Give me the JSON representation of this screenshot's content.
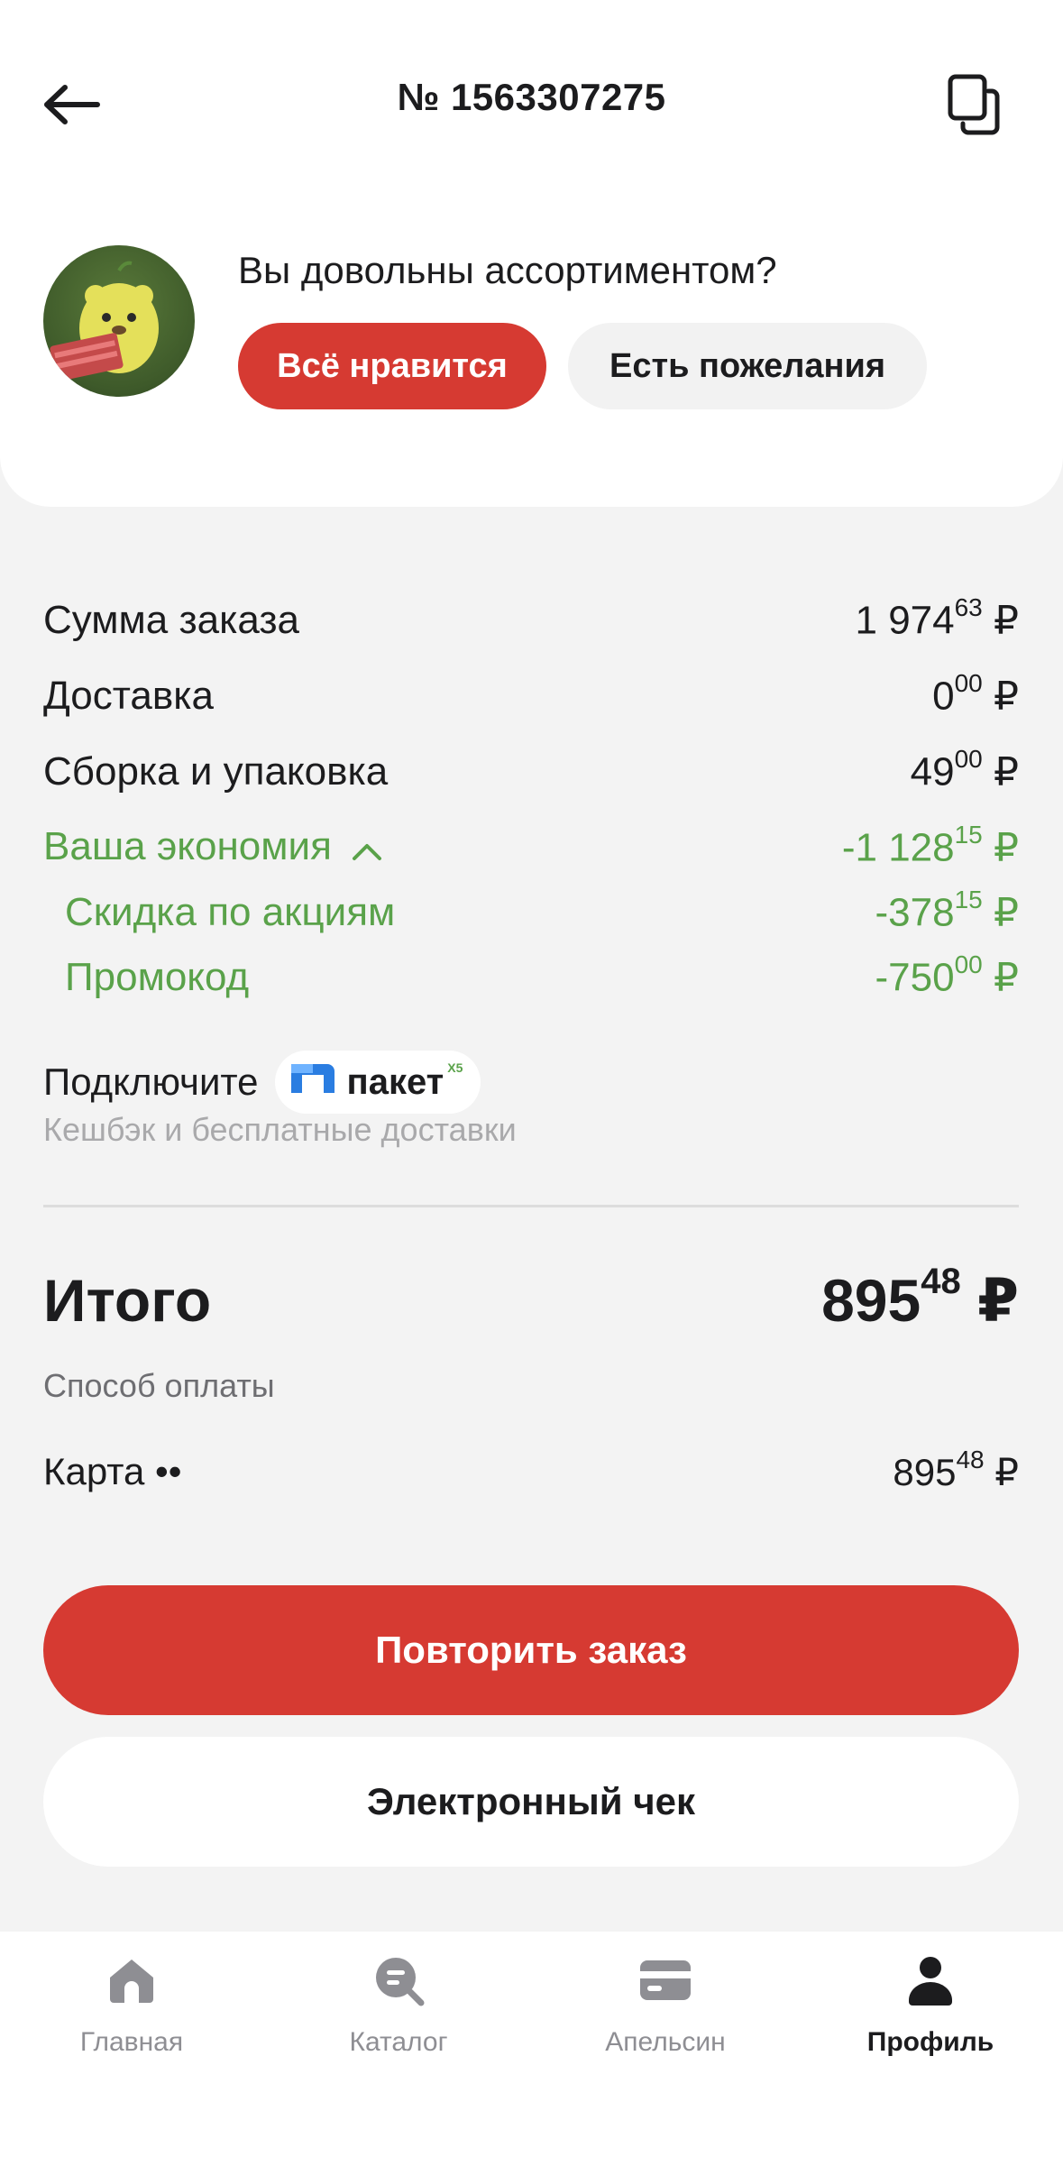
{
  "header": {
    "title": "№ 1563307275"
  },
  "survey": {
    "question": "Вы довольны ассортиментом?",
    "like_label": "Всё нравится",
    "wish_label": "Есть пожелания"
  },
  "summary": {
    "rows": [
      {
        "label": "Сумма заказа",
        "int": "1 974",
        "frac": "63",
        "cur": "₽"
      },
      {
        "label": "Доставка",
        "int": "0",
        "frac": "00",
        "cur": "₽"
      },
      {
        "label": "Сборка и упаковка",
        "int": "49",
        "frac": "00",
        "cur": "₽"
      }
    ],
    "savings": {
      "label": "Ваша экономия",
      "int": "-1 128",
      "frac": "15",
      "cur": "₽"
    },
    "savings_items": [
      {
        "label": "Скидка по акциям",
        "int": "-378",
        "frac": "15",
        "cur": "₽"
      },
      {
        "label": "Промокод",
        "int": "-750",
        "frac": "00",
        "cur": "₽"
      }
    ]
  },
  "paket": {
    "connect_label": "Подключите",
    "logo_text": "пакет",
    "logo_badge": "X5",
    "subtitle": "Кешбэк и бесплатные доставки"
  },
  "total": {
    "label": "Итого",
    "int": "895",
    "frac": "48",
    "cur": "₽"
  },
  "payment": {
    "label": "Способ оплаты",
    "method": "Карта ••",
    "int": "895",
    "frac": "48",
    "cur": "₽"
  },
  "actions": {
    "repeat_label": "Повторить заказ",
    "receipt_label": "Электронный чек"
  },
  "tabbar": {
    "items": [
      {
        "label": "Главная",
        "icon": "home-icon"
      },
      {
        "label": "Каталог",
        "icon": "catalog-search-icon"
      },
      {
        "label": "Апельсин",
        "icon": "card-icon"
      },
      {
        "label": "Профиль",
        "icon": "profile-icon"
      }
    ],
    "active_index": 3
  },
  "colors": {
    "accent_red": "#d63a32",
    "savings_green": "#5aa24a",
    "background": "#f3f3f3"
  }
}
